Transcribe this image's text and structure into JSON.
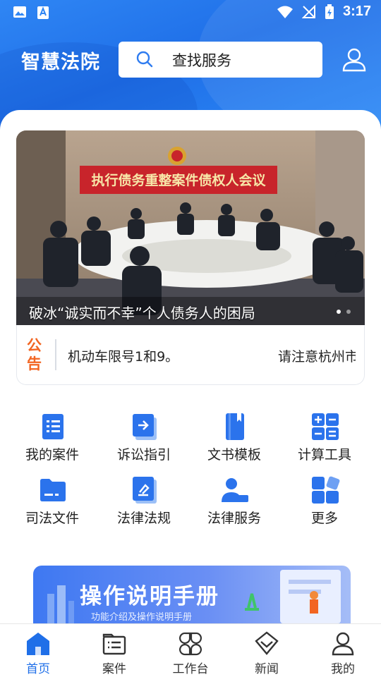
{
  "status_bar": {
    "time": "3:17"
  },
  "header": {
    "app_title": "智慧法院",
    "search_placeholder": "查找服务"
  },
  "banner": {
    "caption": "破冰“诚实而不幸”个人债务人的困局",
    "meeting_banner_text": "执行债务重整案件债权人会议",
    "slide_count": 2,
    "active_slide": 1
  },
  "notice": {
    "tag": "公告",
    "text": "机动车限号1和9。",
    "text_next": "请注意杭州市"
  },
  "services": [
    {
      "label": "我的案件",
      "icon": "case-list-icon"
    },
    {
      "label": "诉讼指引",
      "icon": "guide-icon"
    },
    {
      "label": "文书模板",
      "icon": "document-template-icon"
    },
    {
      "label": "计算工具",
      "icon": "calculator-icon"
    },
    {
      "label": "司法文件",
      "icon": "folder-icon"
    },
    {
      "label": "法律法规",
      "icon": "law-book-icon"
    },
    {
      "label": "法律服务",
      "icon": "legal-service-icon"
    },
    {
      "label": "更多",
      "icon": "more-icon"
    }
  ],
  "manual": {
    "title": "操作说明手册",
    "subtitle": "功能介绍及操作说明手册"
  },
  "bottom_nav": [
    {
      "label": "首页",
      "icon": "home-icon",
      "active": true
    },
    {
      "label": "案件",
      "icon": "case-icon",
      "active": false
    },
    {
      "label": "工作台",
      "icon": "workbench-icon",
      "active": false
    },
    {
      "label": "新闻",
      "icon": "news-icon",
      "active": false
    },
    {
      "label": "我的",
      "icon": "profile-icon",
      "active": false
    }
  ],
  "colors": {
    "primary": "#1f6fe8",
    "notice_accent": "#f26522",
    "text": "#222222"
  }
}
